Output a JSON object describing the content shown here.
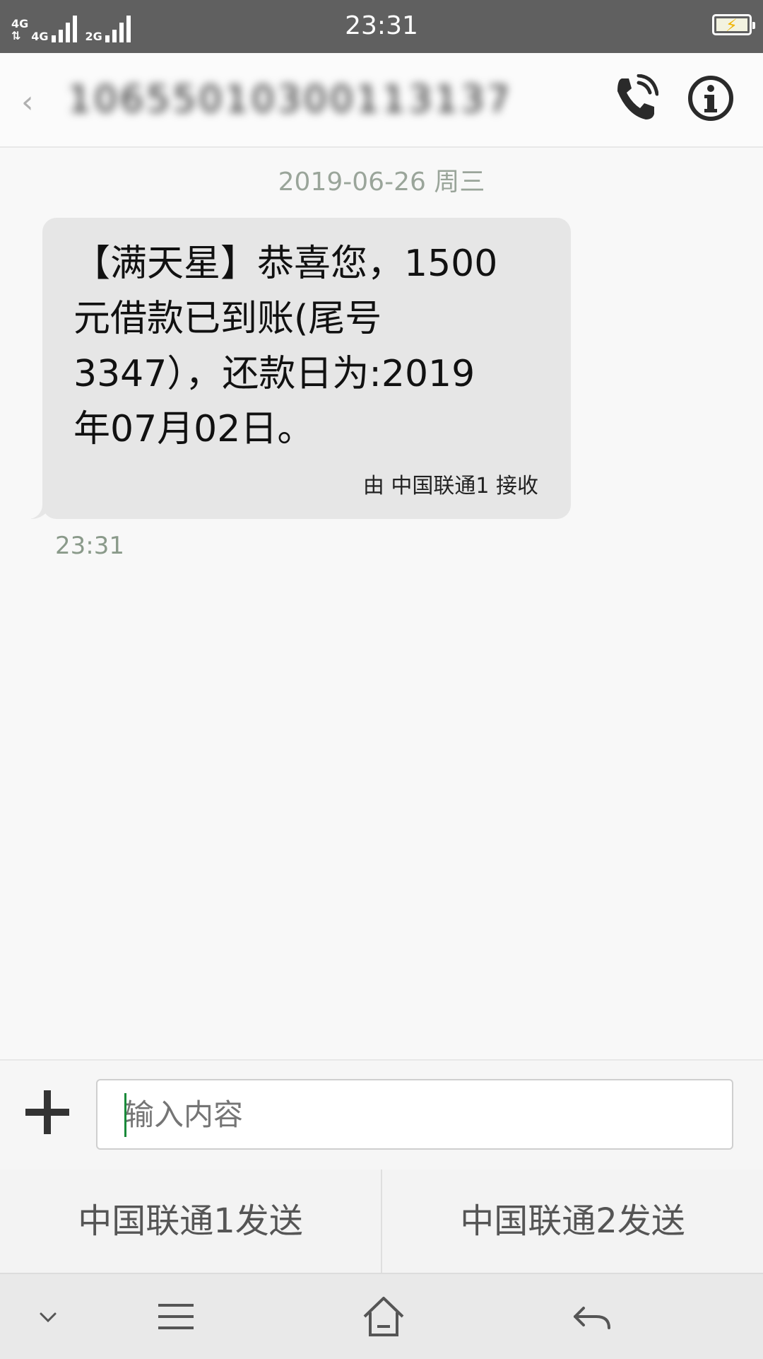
{
  "status_bar": {
    "network_1": "4G",
    "network_2": "4G",
    "network_3": "2G",
    "data_arrows": "⇅",
    "time": "23:31",
    "battery_icon": "battery-charging-icon"
  },
  "header": {
    "contact": "106550103001131378306",
    "call_icon": "phone-call-icon",
    "info_icon": "info-icon"
  },
  "conversation": {
    "date": "2019-06-26 周三",
    "message": {
      "lines": [
        "【满天星】恭喜您，1500",
        "元借款已到账(尾号",
        "3347），还款日为:2019",
        "年07月02日。"
      ],
      "received_via": "由 中国联通1 接收",
      "time": "23:31"
    }
  },
  "composer": {
    "placeholder": "输入内容",
    "add_icon": "plus-icon"
  },
  "send": {
    "sim1": "中国联通1发送",
    "sim2": "中国联通2发送"
  },
  "colors": {
    "status_bar": "#606060",
    "bubble": "#e6e6e6",
    "caret": "#1a8a3a",
    "bolt": "#f0b400"
  }
}
